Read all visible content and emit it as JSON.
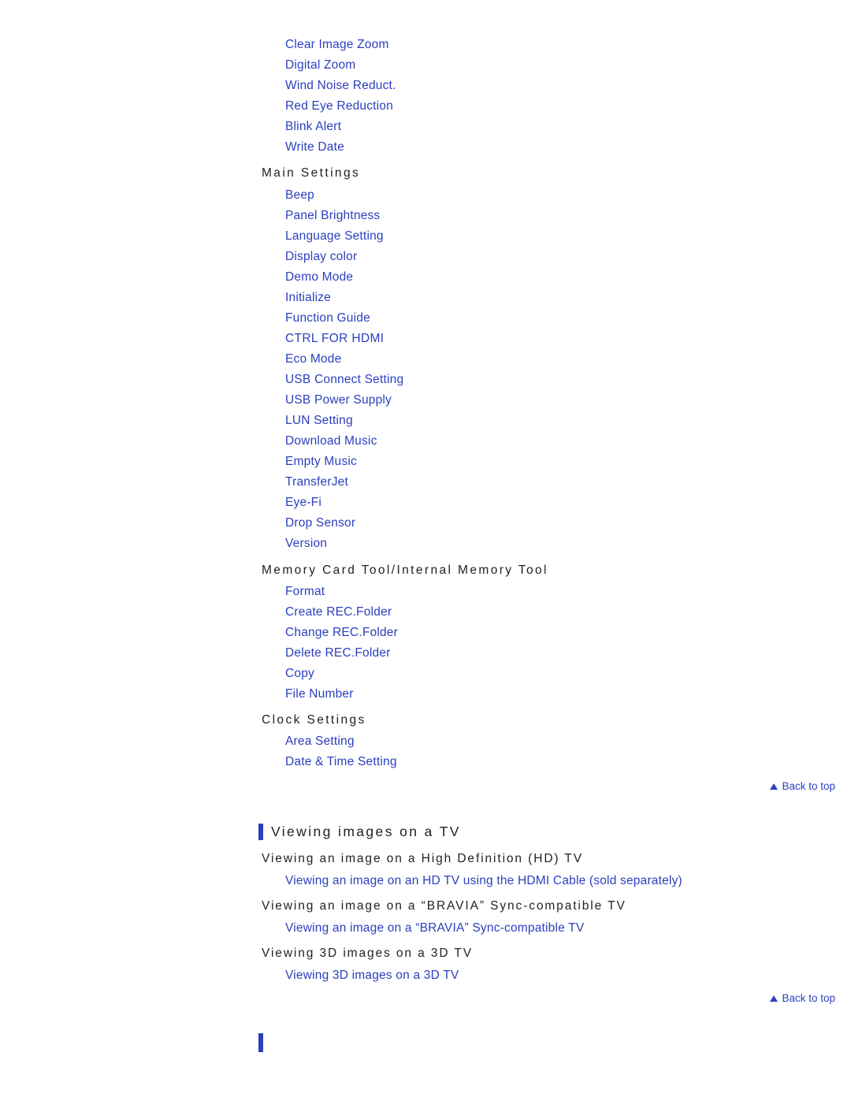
{
  "shooting_links": [
    "Clear Image Zoom",
    "Digital Zoom",
    "Wind Noise Reduct.",
    "Red Eye Reduction",
    "Blink Alert",
    "Write Date"
  ],
  "main_settings": {
    "heading": "Main Settings",
    "links": [
      "Beep",
      "Panel Brightness",
      "Language Setting",
      "Display color",
      "Demo Mode",
      "Initialize",
      "Function Guide",
      "CTRL FOR HDMI",
      "Eco Mode",
      "USB Connect Setting",
      "USB Power Supply",
      "LUN Setting",
      "Download Music",
      "Empty Music",
      "TransferJet",
      "Eye-Fi",
      "Drop Sensor",
      "Version"
    ]
  },
  "memory_card_tool": {
    "heading": "Memory Card Tool/Internal Memory Tool",
    "links": [
      "Format",
      "Create REC.Folder",
      "Change REC.Folder",
      "Delete REC.Folder",
      "Copy",
      "File Number"
    ]
  },
  "clock_settings": {
    "heading": "Clock Settings",
    "links": [
      "Area Setting",
      "Date & Time Setting"
    ]
  },
  "back_to_top": "Back to top",
  "viewing_section": {
    "title": "Viewing images on a TV",
    "groups": [
      {
        "heading": "Viewing an image on a High Definition (HD) TV",
        "link": "Viewing an image on an HD TV using the HDMI Cable (sold separately)"
      },
      {
        "heading": "Viewing an image on a “BRAVIA” Sync-compatible TV",
        "link": "Viewing an image on a “BRAVIA” Sync-compatible TV"
      },
      {
        "heading": "Viewing 3D images on a 3D TV",
        "link": "Viewing 3D images on a 3D TV"
      }
    ]
  },
  "colors": {
    "link": "#2b3fbf",
    "text": "#222222",
    "accent_bar": "#2b3fbf"
  }
}
